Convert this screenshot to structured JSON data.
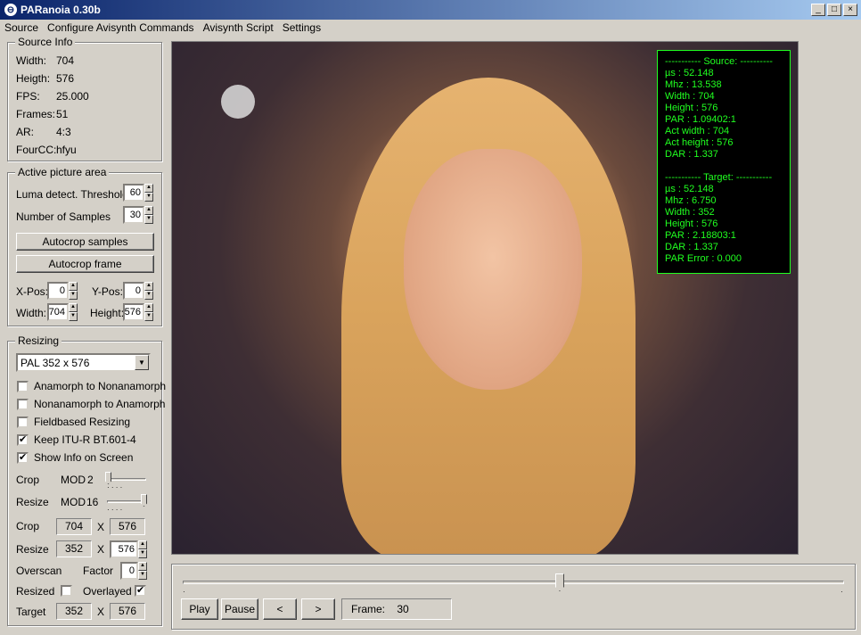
{
  "window": {
    "title": "PARanoia 0.30b",
    "minimize": "_",
    "maximize": "□",
    "close": "×"
  },
  "menu": [
    "Source",
    "Configure Avisynth Commands",
    "Avisynth Script",
    "Settings"
  ],
  "source_info": {
    "title": "Source Info",
    "rows": [
      {
        "label": "Width:",
        "value": "704"
      },
      {
        "label": "Heigth:",
        "value": "576"
      },
      {
        "label": "FPS:",
        "value": "25.000"
      },
      {
        "label": "Frames:",
        "value": "51"
      },
      {
        "label": "AR:",
        "value": "4:3"
      },
      {
        "label": "FourCC:",
        "value": "hfyu"
      }
    ]
  },
  "active_area": {
    "title": "Active picture area",
    "luma_label": "Luma detect. Threshold",
    "luma_value": "60",
    "samples_label": "Number of Samples",
    "samples_value": "30",
    "autocrop_samples": "Autocrop samples",
    "autocrop_frame": "Autocrop frame",
    "xpos_label": "X-Pos:",
    "xpos_value": "0",
    "ypos_label": "Y-Pos:",
    "ypos_value": "0",
    "width_label": "Width:",
    "width_value": "704",
    "height_label": "Height:",
    "height_value": "576"
  },
  "resizing": {
    "title": "Resizing",
    "preset": "PAL  352 x 576",
    "checkboxes": [
      {
        "label": "Anamorph to Nonanamorph",
        "checked": false
      },
      {
        "label": "Nonanamorph to Anamorph",
        "checked": false
      },
      {
        "label": "Fieldbased Resizing",
        "checked": false
      },
      {
        "label": "Keep ITU-R BT.601-4",
        "checked": true
      },
      {
        "label": "Show Info on Screen",
        "checked": true
      }
    ],
    "crop_label": "Crop",
    "crop_mod_label": "MOD",
    "crop_mod": "2",
    "resize_label": "Resize",
    "resize_mod_label": "MOD",
    "resize_mod": "16",
    "crop_w": "704",
    "crop_h": "576",
    "x_sep": "X",
    "resize_w": "352",
    "resize_h": "576",
    "overscan_label": "Overscan",
    "factor_label": "Factor",
    "factor_value": "0",
    "resized_label": "Resized",
    "resized_checked": false,
    "overlayed_label": "Overlayed",
    "overlayed_checked": true,
    "target_label": "Target",
    "target_w": "352",
    "target_h": "576"
  },
  "info_overlay": [
    "----------- Source: ----------",
    "µs : 52.148",
    "Mhz : 13.538",
    "Width : 704",
    "Height : 576",
    "PAR : 1.09402:1",
    "Act width : 704",
    "Act height : 576",
    "DAR : 1.337",
    "",
    "----------- Target: -----------",
    "µs : 52.148",
    "Mhz : 6.750",
    "Width : 352",
    "Height : 576",
    "PAR : 2.18803:1",
    "DAR : 1.337",
    "PAR Error : 0.000"
  ],
  "playback": {
    "play": "Play",
    "pause": "Pause",
    "prev": "<",
    "next": ">",
    "frame_label": "Frame:",
    "frame_value": "30",
    "position_fraction": 0.57
  },
  "colors": {
    "overlay_text": "#20ff20",
    "titlebar": "#0a246a"
  }
}
